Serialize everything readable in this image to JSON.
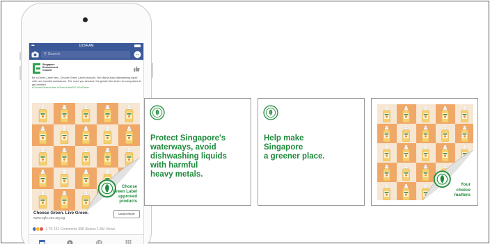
{
  "phone": {
    "status": {
      "carrier": "•••••",
      "time": "10:54 AM"
    },
    "search": {
      "placeholder": "Search"
    },
    "post": {
      "page_name_lines": [
        "Singapore",
        "Environment",
        "Council"
      ],
      "body_text": "Be a Green Label hero. Choose Green Label products, like Mama lloyd dishwashing liquid with zero harmful substances. The more you demand, the greater the desire for companies to get certified.",
      "hashtags": "#ChooseGreenLabel #GreenLabelSG #GoGreen",
      "ad_caption_lines": [
        "Choose",
        "Green Label",
        "approved",
        "products"
      ],
      "link_title": "Choose Green. Live Green.",
      "link_url": "www.sgls.sec.org.sg",
      "cta_label": "Learn More",
      "reaction_stats": "2.7K   141 Comments   398 Shares   1.5M Views"
    }
  },
  "cards": [
    {
      "lines": [
        "Protect Singapore's",
        "waterways, avoid",
        "dishwashing liquids",
        "with harmful",
        "heavy metals."
      ]
    },
    {
      "lines": [
        "Help make",
        "Singapore",
        "a greener place."
      ]
    }
  ],
  "card4": {
    "caption_lines": [
      "Your",
      "choice",
      "matters"
    ]
  },
  "colors": {
    "brand_green": "#1e8a3c",
    "facebook_blue": "#3b5998",
    "tile_orange": "#f0a868",
    "tile_cream": "#f6e6d2"
  },
  "icons": [
    "camera-icon",
    "messenger-icon",
    "like-icon",
    "news-feed-icon",
    "play-icon",
    "globe-icon",
    "grid-menu-icon",
    "green-label-seal-icon"
  ]
}
